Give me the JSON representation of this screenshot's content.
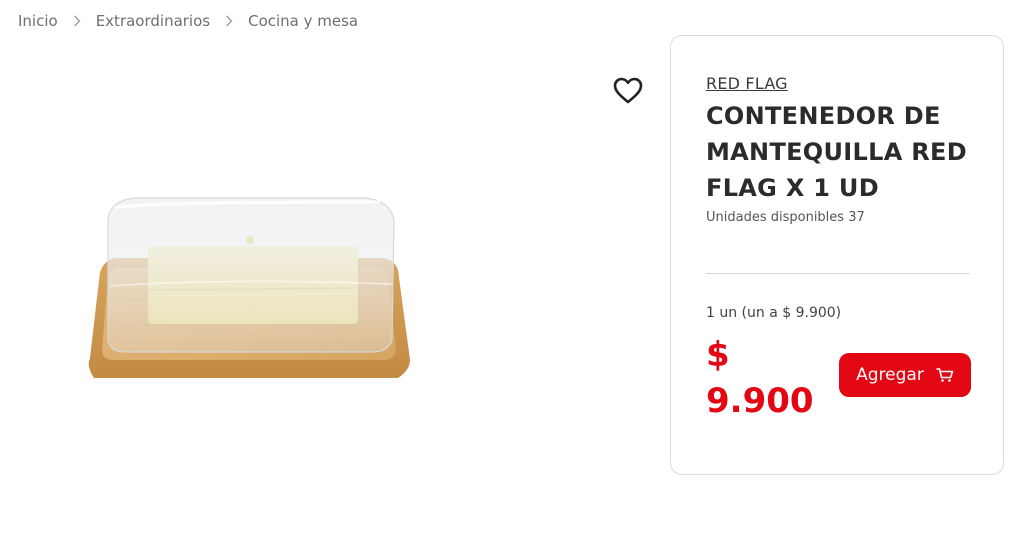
{
  "breadcrumb": {
    "items": [
      {
        "label": "Inicio"
      },
      {
        "label": "Extraordinarios"
      },
      {
        "label": "Cocina y mesa"
      }
    ],
    "separator_icon": "chevron-right-icon"
  },
  "product": {
    "image_icon": "butter-dish-image",
    "favorite_icon": "heart-outline-icon",
    "brand": "RED FLAG",
    "title": "CONTENEDOR DE MANTEQUILLA RED FLAG X 1 UD",
    "stock": "Unidades disponibles 37",
    "unit_price": "1 un (un a $ 9.900)",
    "price": "$ 9.900",
    "add_button_label": "Agregar",
    "add_button_icon": "cart-icon"
  },
  "colors": {
    "accent": "#e30613",
    "text_dark": "#2b2b2b",
    "text_muted": "#6f6f6f",
    "border": "#dcdcdc"
  }
}
